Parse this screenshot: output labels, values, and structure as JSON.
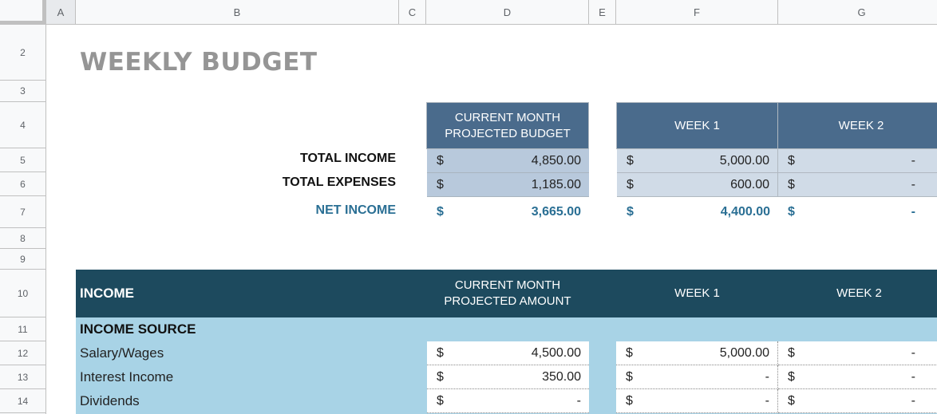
{
  "sheet": {
    "columns": [
      "A",
      "B",
      "C",
      "D",
      "E",
      "F",
      "G"
    ],
    "rows": [
      "2",
      "3",
      "4",
      "5",
      "6",
      "7",
      "8",
      "9",
      "10",
      "11",
      "12",
      "13",
      "14"
    ]
  },
  "title": "WEEKLY BUDGET",
  "summary": {
    "headers": {
      "current_month": "CURRENT MONTH PROJECTED BUDGET",
      "week1": "WEEK 1",
      "week2": "WEEK 2"
    },
    "rows": [
      {
        "label": "TOTAL INCOME",
        "currency": "$",
        "current_month": "4,850.00",
        "week1": "5,000.00",
        "week2": "-"
      },
      {
        "label": "TOTAL EXPENSES",
        "currency": "$",
        "current_month": "1,185.00",
        "week1": "600.00",
        "week2": "-"
      },
      {
        "label": "NET INCOME",
        "currency": "$",
        "current_month": "3,665.00",
        "week1": "4,400.00",
        "week2": "-"
      }
    ]
  },
  "income": {
    "section_title": "INCOME",
    "headers": {
      "current_month": "CURRENT MONTH PROJECTED AMOUNT",
      "week1": "WEEK 1",
      "week2": "WEEK 2"
    },
    "source_label": "INCOME SOURCE",
    "items": [
      {
        "label": "Salary/Wages",
        "currency": "$",
        "current_month": "4,500.00",
        "week1": "5,000.00",
        "week2": "-"
      },
      {
        "label": "Interest Income",
        "currency": "$",
        "current_month": "350.00",
        "week1": "-",
        "week2": "-"
      },
      {
        "label": "Dividends",
        "currency": "$",
        "current_month": "-",
        "week1": "-",
        "week2": "-"
      }
    ]
  },
  "colors": {
    "summary_header": "#4a6b8c",
    "summary_current_cell": "#b8c9dc",
    "summary_week_cell": "#d0dbe7",
    "net_income_text": "#2a6f94",
    "income_header": "#1d4a5e",
    "income_body": "#a8d3e6",
    "title_text": "#959595"
  }
}
